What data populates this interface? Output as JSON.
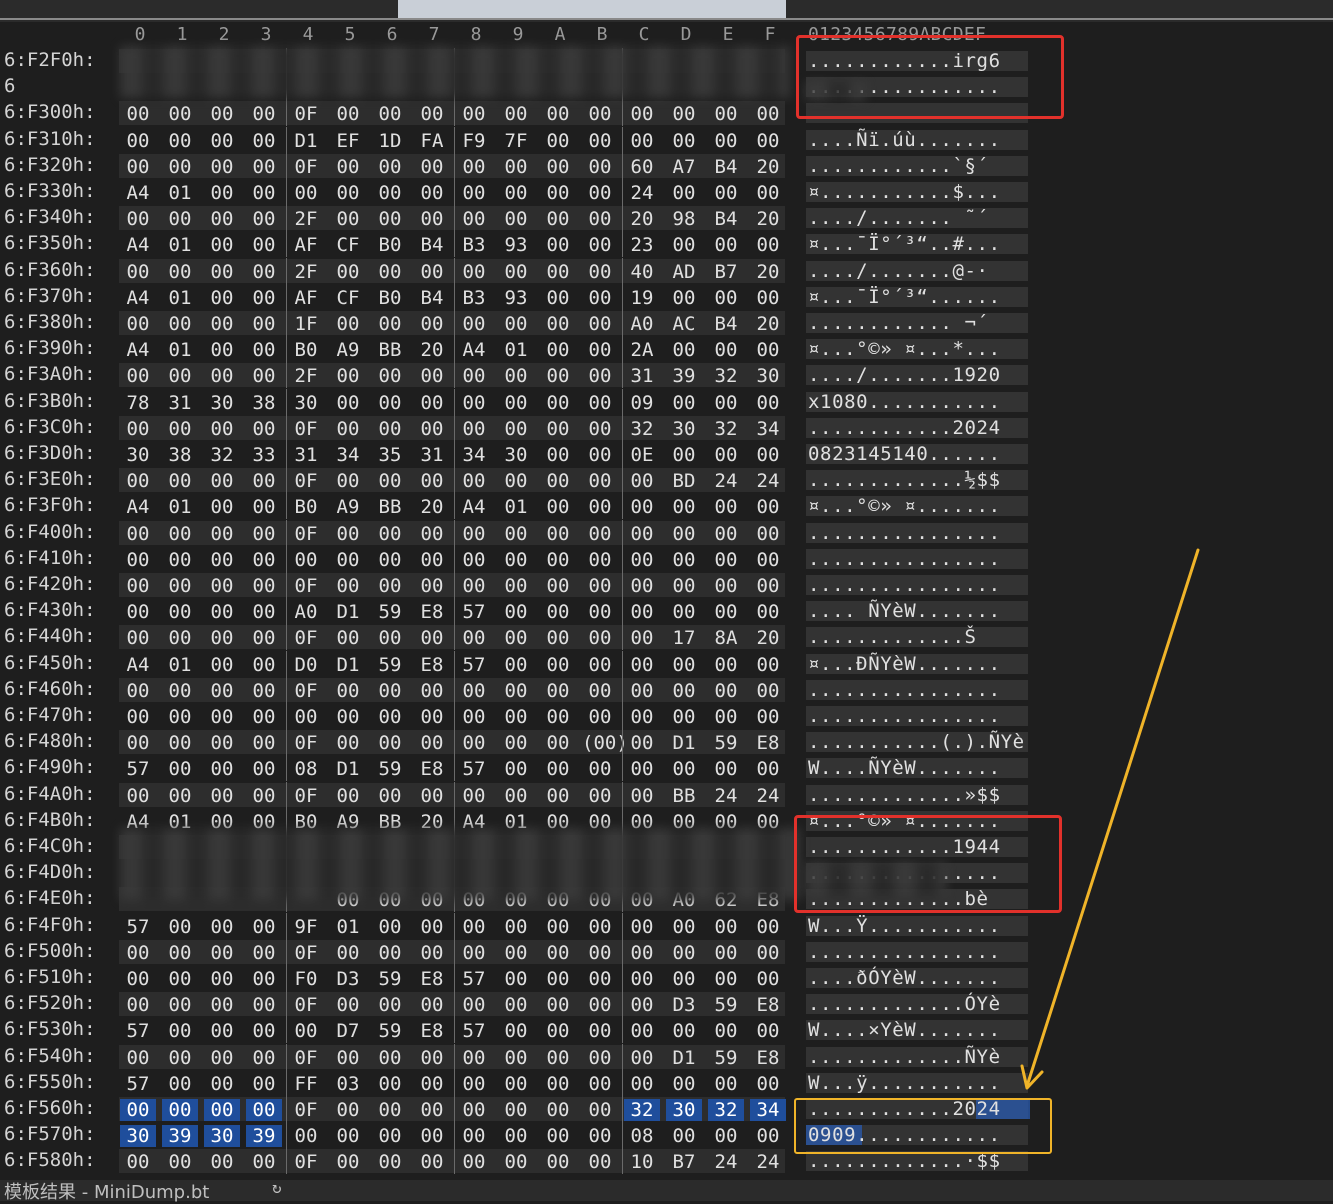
{
  "column_headers": [
    "0",
    "1",
    "2",
    "3",
    "4",
    "5",
    "6",
    "7",
    "8",
    "9",
    "A",
    "B",
    "C",
    "D",
    "E",
    "F"
  ],
  "ascii_header": "0123456789ABCDEF",
  "rows": [
    {
      "addr": "6:F2F0h:",
      "bytes": [
        "",
        "",
        "",
        "",
        "",
        "",
        "",
        "",
        "",
        "",
        "",
        "",
        "",
        "",
        "",
        ""
      ],
      "ascii": "............irg6",
      "redacted": true
    },
    {
      "addr": "6",
      "bytes": [
        "",
        "",
        "",
        "",
        "",
        "",
        "",
        "",
        "",
        "",
        "",
        "",
        "",
        "",
        "",
        ""
      ],
      "ascii": "................",
      "redacted": true
    },
    {
      "addr": "6:F300h:",
      "bytes": [
        "00",
        "00",
        "00",
        "00",
        "0F",
        "00",
        "00",
        "00",
        "00",
        "00",
        "00",
        "00",
        "00",
        "00",
        "00",
        "00"
      ],
      "ascii": "................"
    },
    {
      "addr": "6:F310h:",
      "bytes": [
        "00",
        "00",
        "00",
        "00",
        "D1",
        "EF",
        "1D",
        "FA",
        "F9",
        "7F",
        "00",
        "00",
        "00",
        "00",
        "00",
        "00"
      ],
      "ascii": "....Ñï.úù......."
    },
    {
      "addr": "6:F320h:",
      "bytes": [
        "00",
        "00",
        "00",
        "00",
        "0F",
        "00",
        "00",
        "00",
        "00",
        "00",
        "00",
        "00",
        "60",
        "A7",
        "B4",
        "20"
      ],
      "ascii": "............`§´ "
    },
    {
      "addr": "6:F330h:",
      "bytes": [
        "A4",
        "01",
        "00",
        "00",
        "00",
        "00",
        "00",
        "00",
        "00",
        "00",
        "00",
        "00",
        "24",
        "00",
        "00",
        "00"
      ],
      "ascii": "¤...........$..."
    },
    {
      "addr": "6:F340h:",
      "bytes": [
        "00",
        "00",
        "00",
        "00",
        "2F",
        "00",
        "00",
        "00",
        "00",
        "00",
        "00",
        "00",
        "20",
        "98",
        "B4",
        "20"
      ],
      "ascii": "..../....... ˜´ "
    },
    {
      "addr": "6:F350h:",
      "bytes": [
        "A4",
        "01",
        "00",
        "00",
        "AF",
        "CF",
        "B0",
        "B4",
        "B3",
        "93",
        "00",
        "00",
        "23",
        "00",
        "00",
        "00"
      ],
      "ascii": "¤...¯Ï°´³“..#..."
    },
    {
      "addr": "6:F360h:",
      "bytes": [
        "00",
        "00",
        "00",
        "00",
        "2F",
        "00",
        "00",
        "00",
        "00",
        "00",
        "00",
        "00",
        "40",
        "AD",
        "B7",
        "20"
      ],
      "ascii": "..../.......@-· "
    },
    {
      "addr": "6:F370h:",
      "bytes": [
        "A4",
        "01",
        "00",
        "00",
        "AF",
        "CF",
        "B0",
        "B4",
        "B3",
        "93",
        "00",
        "00",
        "19",
        "00",
        "00",
        "00"
      ],
      "ascii": "¤...¯Ï°´³“......"
    },
    {
      "addr": "6:F380h:",
      "bytes": [
        "00",
        "00",
        "00",
        "00",
        "1F",
        "00",
        "00",
        "00",
        "00",
        "00",
        "00",
        "00",
        "A0",
        "AC",
        "B4",
        "20"
      ],
      "ascii": "............ ¬´ "
    },
    {
      "addr": "6:F390h:",
      "bytes": [
        "A4",
        "01",
        "00",
        "00",
        "B0",
        "A9",
        "BB",
        "20",
        "A4",
        "01",
        "00",
        "00",
        "2A",
        "00",
        "00",
        "00"
      ],
      "ascii": "¤...°©» ¤...*..."
    },
    {
      "addr": "6:F3A0h:",
      "bytes": [
        "00",
        "00",
        "00",
        "00",
        "2F",
        "00",
        "00",
        "00",
        "00",
        "00",
        "00",
        "00",
        "31",
        "39",
        "32",
        "30"
      ],
      "ascii": "..../.......1920"
    },
    {
      "addr": "6:F3B0h:",
      "bytes": [
        "78",
        "31",
        "30",
        "38",
        "30",
        "00",
        "00",
        "00",
        "00",
        "00",
        "00",
        "00",
        "09",
        "00",
        "00",
        "00"
      ],
      "ascii": "x1080..........."
    },
    {
      "addr": "6:F3C0h:",
      "bytes": [
        "00",
        "00",
        "00",
        "00",
        "0F",
        "00",
        "00",
        "00",
        "00",
        "00",
        "00",
        "00",
        "32",
        "30",
        "32",
        "34"
      ],
      "ascii": "............2024"
    },
    {
      "addr": "6:F3D0h:",
      "bytes": [
        "30",
        "38",
        "32",
        "33",
        "31",
        "34",
        "35",
        "31",
        "34",
        "30",
        "00",
        "00",
        "0E",
        "00",
        "00",
        "00"
      ],
      "ascii": "0823145140......"
    },
    {
      "addr": "6:F3E0h:",
      "bytes": [
        "00",
        "00",
        "00",
        "00",
        "0F",
        "00",
        "00",
        "00",
        "00",
        "00",
        "00",
        "00",
        "00",
        "BD",
        "24",
        "24"
      ],
      "ascii": ".............½$$"
    },
    {
      "addr": "6:F3F0h:",
      "bytes": [
        "A4",
        "01",
        "00",
        "00",
        "B0",
        "A9",
        "BB",
        "20",
        "A4",
        "01",
        "00",
        "00",
        "00",
        "00",
        "00",
        "00"
      ],
      "ascii": "¤...°©» ¤......."
    },
    {
      "addr": "6:F400h:",
      "bytes": [
        "00",
        "00",
        "00",
        "00",
        "0F",
        "00",
        "00",
        "00",
        "00",
        "00",
        "00",
        "00",
        "00",
        "00",
        "00",
        "00"
      ],
      "ascii": "................"
    },
    {
      "addr": "6:F410h:",
      "bytes": [
        "00",
        "00",
        "00",
        "00",
        "00",
        "00",
        "00",
        "00",
        "00",
        "00",
        "00",
        "00",
        "00",
        "00",
        "00",
        "00"
      ],
      "ascii": "................"
    },
    {
      "addr": "6:F420h:",
      "bytes": [
        "00",
        "00",
        "00",
        "00",
        "0F",
        "00",
        "00",
        "00",
        "00",
        "00",
        "00",
        "00",
        "00",
        "00",
        "00",
        "00"
      ],
      "ascii": "................"
    },
    {
      "addr": "6:F430h:",
      "bytes": [
        "00",
        "00",
        "00",
        "00",
        "A0",
        "D1",
        "59",
        "E8",
        "57",
        "00",
        "00",
        "00",
        "00",
        "00",
        "00",
        "00"
      ],
      "ascii": ".... ÑYèW......."
    },
    {
      "addr": "6:F440h:",
      "bytes": [
        "00",
        "00",
        "00",
        "00",
        "0F",
        "00",
        "00",
        "00",
        "00",
        "00",
        "00",
        "00",
        "00",
        "17",
        "8A",
        "20"
      ],
      "ascii": ".............Š "
    },
    {
      "addr": "6:F450h:",
      "bytes": [
        "A4",
        "01",
        "00",
        "00",
        "D0",
        "D1",
        "59",
        "E8",
        "57",
        "00",
        "00",
        "00",
        "00",
        "00",
        "00",
        "00"
      ],
      "ascii": "¤...ÐÑYèW......."
    },
    {
      "addr": "6:F460h:",
      "bytes": [
        "00",
        "00",
        "00",
        "00",
        "0F",
        "00",
        "00",
        "00",
        "00",
        "00",
        "00",
        "00",
        "00",
        "00",
        "00",
        "00"
      ],
      "ascii": "................"
    },
    {
      "addr": "6:F470h:",
      "bytes": [
        "00",
        "00",
        "00",
        "00",
        "00",
        "00",
        "00",
        "00",
        "00",
        "00",
        "00",
        "00",
        "00",
        "00",
        "00",
        "00"
      ],
      "ascii": "................"
    },
    {
      "addr": "6:F480h:",
      "bytes": [
        "00",
        "00",
        "00",
        "00",
        "0F",
        "00",
        "00",
        "00",
        "00",
        "00",
        "00",
        "(00)",
        "00",
        "D1",
        "59",
        "E8"
      ],
      "ascii": "...........(.).ÑYè"
    },
    {
      "addr": "6:F490h:",
      "bytes": [
        "57",
        "00",
        "00",
        "00",
        "08",
        "D1",
        "59",
        "E8",
        "57",
        "00",
        "00",
        "00",
        "00",
        "00",
        "00",
        "00"
      ],
      "ascii": "W....ÑYèW......."
    },
    {
      "addr": "6:F4A0h:",
      "bytes": [
        "00",
        "00",
        "00",
        "00",
        "0F",
        "00",
        "00",
        "00",
        "00",
        "00",
        "00",
        "00",
        "00",
        "BB",
        "24",
        "24"
      ],
      "ascii": ".............»$$"
    },
    {
      "addr": "6:F4B0h:",
      "bytes": [
        "A4",
        "01",
        "00",
        "00",
        "B0",
        "A9",
        "BB",
        "20",
        "A4",
        "01",
        "00",
        "00",
        "00",
        "00",
        "00",
        "00"
      ],
      "ascii": "¤...°©» ¤......."
    },
    {
      "addr": "6:F4C0h:",
      "bytes": [
        "",
        "",
        "",
        "",
        "",
        "",
        "",
        "",
        "",
        "",
        "",
        "",
        "",
        "",
        "",
        ""
      ],
      "ascii": "............1944",
      "redacted": true
    },
    {
      "addr": "6:F4D0h:",
      "bytes": [
        "",
        "",
        "",
        "",
        "",
        "",
        "",
        "",
        "",
        "",
        "",
        "",
        "",
        "",
        "",
        ""
      ],
      "ascii": "................",
      "redacted": true
    },
    {
      "addr": "6:F4E0h:",
      "bytes": [
        "",
        "",
        "",
        "",
        "",
        "00",
        "00",
        "00",
        "00",
        "00",
        "00",
        "00",
        "00",
        "A0",
        "62",
        "E8"
      ],
      "ascii": ".............bè",
      "partial": true
    },
    {
      "addr": "6:F4F0h:",
      "bytes": [
        "57",
        "00",
        "00",
        "00",
        "9F",
        "01",
        "00",
        "00",
        "00",
        "00",
        "00",
        "00",
        "00",
        "00",
        "00",
        "00"
      ],
      "ascii": "W...Ÿ..........."
    },
    {
      "addr": "6:F500h:",
      "bytes": [
        "00",
        "00",
        "00",
        "00",
        "0F",
        "00",
        "00",
        "00",
        "00",
        "00",
        "00",
        "00",
        "00",
        "00",
        "00",
        "00"
      ],
      "ascii": "................"
    },
    {
      "addr": "6:F510h:",
      "bytes": [
        "00",
        "00",
        "00",
        "00",
        "F0",
        "D3",
        "59",
        "E8",
        "57",
        "00",
        "00",
        "00",
        "00",
        "00",
        "00",
        "00"
      ],
      "ascii": "....ðÓYèW......."
    },
    {
      "addr": "6:F520h:",
      "bytes": [
        "00",
        "00",
        "00",
        "00",
        "0F",
        "00",
        "00",
        "00",
        "00",
        "00",
        "00",
        "00",
        "00",
        "D3",
        "59",
        "E8"
      ],
      "ascii": ".............ÓYè"
    },
    {
      "addr": "6:F530h:",
      "bytes": [
        "57",
        "00",
        "00",
        "00",
        "00",
        "D7",
        "59",
        "E8",
        "57",
        "00",
        "00",
        "00",
        "00",
        "00",
        "00",
        "00"
      ],
      "ascii": "W....×YèW......."
    },
    {
      "addr": "6:F540h:",
      "bytes": [
        "00",
        "00",
        "00",
        "00",
        "0F",
        "00",
        "00",
        "00",
        "00",
        "00",
        "00",
        "00",
        "00",
        "D1",
        "59",
        "E8"
      ],
      "ascii": ".............ÑYè"
    },
    {
      "addr": "6:F550h:",
      "bytes": [
        "57",
        "00",
        "00",
        "00",
        "FF",
        "03",
        "00",
        "00",
        "00",
        "00",
        "00",
        "00",
        "00",
        "00",
        "00",
        "00"
      ],
      "ascii": "W...ÿ..........."
    },
    {
      "addr": "6:F560h:",
      "bytes": [
        "00",
        "00",
        "00",
        "00",
        "0F",
        "00",
        "00",
        "00",
        "00",
        "00",
        "00",
        "00",
        "32",
        "30",
        "32",
        "34"
      ],
      "ascii": "............2024",
      "selected": [
        0,
        1,
        2,
        3,
        12,
        13,
        14,
        15
      ]
    },
    {
      "addr": "6:F570h:",
      "bytes": [
        "30",
        "39",
        "30",
        "39",
        "00",
        "00",
        "00",
        "00",
        "00",
        "00",
        "00",
        "00",
        "08",
        "00",
        "00",
        "00"
      ],
      "ascii": "0909............",
      "selected": [
        0,
        1,
        2,
        3
      ]
    },
    {
      "addr": "6:F580h:",
      "bytes": [
        "00",
        "00",
        "00",
        "00",
        "0F",
        "00",
        "00",
        "00",
        "00",
        "00",
        "00",
        "00",
        "10",
        "B7",
        "24",
        "24"
      ],
      "ascii": ".............·$$"
    }
  ],
  "status_bar": {
    "label": "模板结果 - MiniDump.bt",
    "icon": "refresh-icon"
  },
  "colors": {
    "background": "#1e1e1e",
    "selection": "#2a5bb0",
    "annotation_red": "#e2312b",
    "annotation_yellow": "#f0b429"
  }
}
